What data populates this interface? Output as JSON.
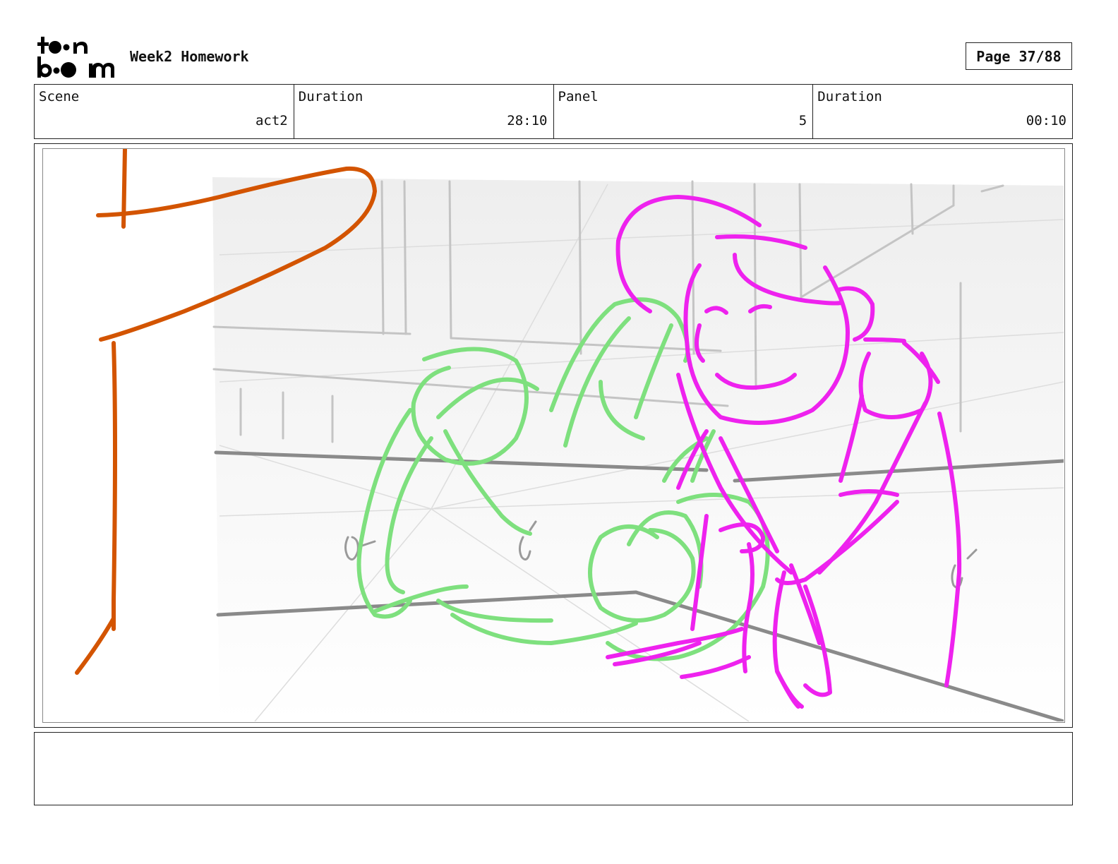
{
  "header": {
    "logo_text": "toon boom",
    "title": "Week2 Homework",
    "page": "Page 37/88"
  },
  "info": {
    "scene_label": "Scene",
    "scene_value": "act2",
    "duration_label": "Duration",
    "duration_value": "28:10",
    "panel_label": "Panel",
    "panel_value": "5",
    "panel_duration_label": "Duration",
    "panel_duration_value": "00:10"
  },
  "notes": {
    "text": ""
  },
  "colors": {
    "camera_path": "#d35400",
    "character_green": "#7ee07e",
    "character_magenta": "#ee22ee",
    "background_lines": "#999999"
  }
}
